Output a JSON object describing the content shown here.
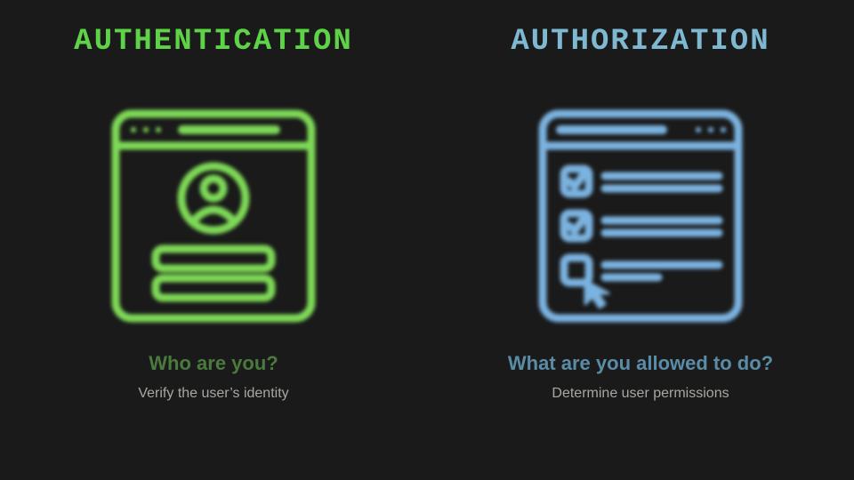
{
  "left": {
    "title": "AUTHENTICATION",
    "question": "Who are you?",
    "desc": "Verify the user’s identity",
    "color": "#7ed957"
  },
  "right": {
    "title": "AUTHORIZATION",
    "question": "What are you allowed to do?",
    "desc": "Determine user permissions",
    "color": "#7bb3e0"
  }
}
